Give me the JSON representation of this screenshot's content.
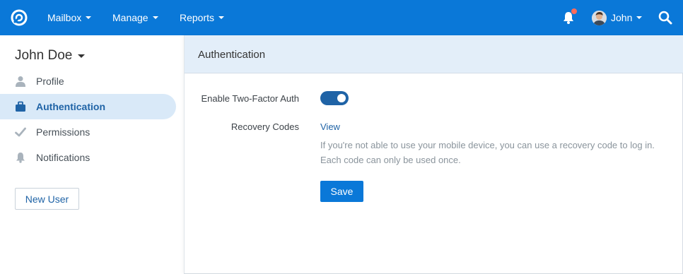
{
  "topbar": {
    "logo_icon": "helpscout-logo-icon",
    "nav": [
      {
        "label": "Mailbox"
      },
      {
        "label": "Manage"
      },
      {
        "label": "Reports"
      }
    ],
    "notification_icon": "bell-icon",
    "has_notification": true,
    "user_name": "John",
    "search_icon": "search-icon",
    "brand_color": "#0a78d8"
  },
  "sidebar": {
    "title": "John Doe",
    "items": [
      {
        "label": "Profile",
        "icon": "user-icon",
        "active": false
      },
      {
        "label": "Authentication",
        "icon": "briefcase-icon",
        "active": true
      },
      {
        "label": "Permissions",
        "icon": "check-icon",
        "active": false
      },
      {
        "label": "Notifications",
        "icon": "bell-icon",
        "active": false
      }
    ],
    "new_user_label": "New User"
  },
  "main": {
    "title": "Authentication",
    "two_factor": {
      "label": "Enable Two-Factor Auth",
      "enabled": true
    },
    "recovery": {
      "label": "Recovery Codes",
      "link": "View",
      "help_line1": "If you're not able to use your mobile device, you can use a recovery code to log in.",
      "help_line2": "Each code can only be used once."
    },
    "save_label": "Save"
  }
}
